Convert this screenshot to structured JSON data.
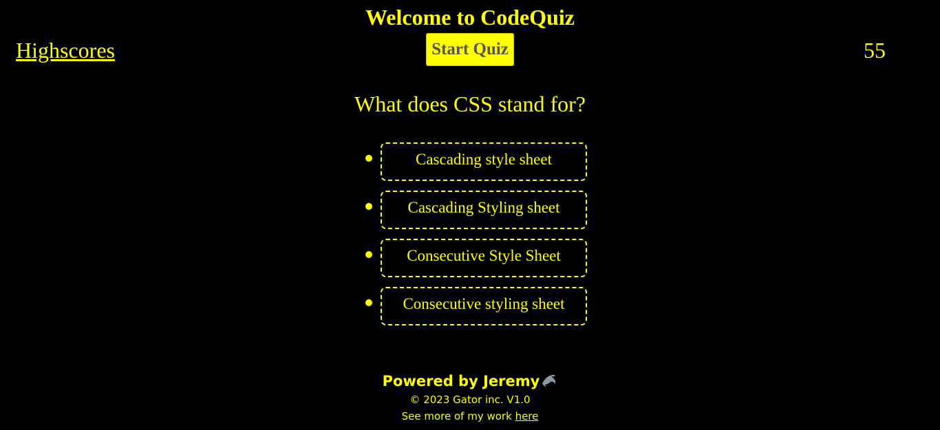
{
  "header": {
    "title": "Welcome to CodeQuiz",
    "highscores_label": "Highscores",
    "start_button_label": "Start Quiz",
    "timer_value": "55"
  },
  "quiz": {
    "question": "What does CSS stand for?",
    "answers": [
      "Cascading style sheet",
      "Cascading Styling sheet",
      "Consecutive Style Sheet",
      "Consecutive styling sheet"
    ]
  },
  "footer": {
    "powered_by": "Powered by Jeremy",
    "copyright": "© 2023 Gator inc. V1.0",
    "more_text": "See more of my work",
    "more_link": "here",
    "icon": "dolphin-icon"
  },
  "colors": {
    "background": "#000000",
    "accent": "#ffff00",
    "button_text": "#555555"
  }
}
